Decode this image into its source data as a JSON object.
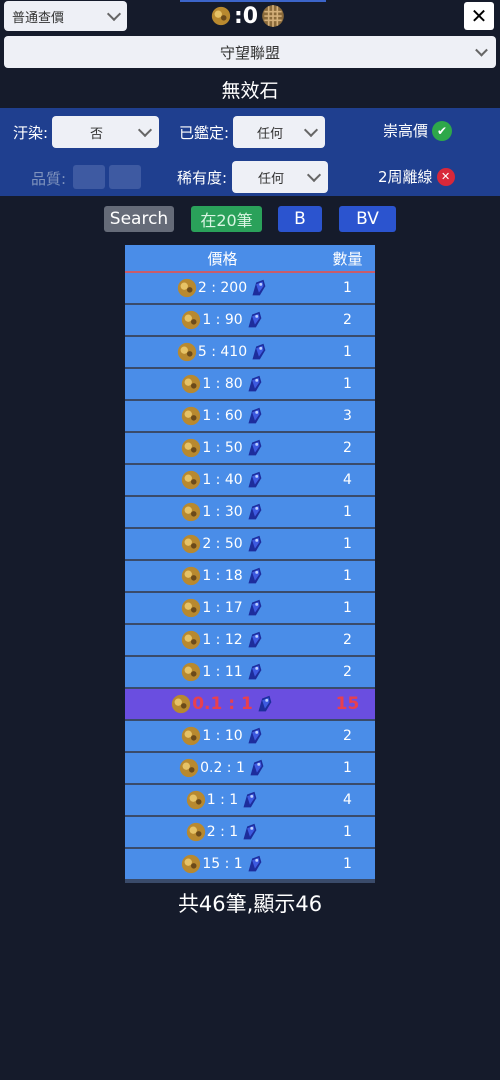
{
  "header": {
    "query_mode": "普通查價",
    "orb_count": ":0",
    "close_label": "✕",
    "league": "守望聯盟",
    "item_name": "無效石"
  },
  "filters": {
    "corrupted_label": "汙染:",
    "corrupted_value": "否",
    "identified_label": "已鑑定:",
    "identified_value": "任何",
    "exalted_label": "崇高價",
    "quality_label": "品質:",
    "rarity_label": "稀有度:",
    "rarity_value": "任何",
    "offline_label": "2周離線"
  },
  "actions": {
    "search": "Search",
    "count": "在20筆",
    "b": "B",
    "bv": "BV"
  },
  "table": {
    "headers": {
      "price": "價格",
      "qty": "數量"
    },
    "rows": [
      {
        "price": "2 : 200",
        "qty": "1"
      },
      {
        "price": "1 : 90",
        "qty": "2"
      },
      {
        "price": "5 : 410",
        "qty": "1"
      },
      {
        "price": "1 : 80",
        "qty": "1"
      },
      {
        "price": "1 : 60",
        "qty": "3"
      },
      {
        "price": "1 : 50",
        "qty": "2"
      },
      {
        "price": "1 : 40",
        "qty": "4"
      },
      {
        "price": "1 : 30",
        "qty": "1"
      },
      {
        "price": "2 : 50",
        "qty": "1"
      },
      {
        "price": "1 : 18",
        "qty": "1"
      },
      {
        "price": "1 : 17",
        "qty": "1"
      },
      {
        "price": "1 : 12",
        "qty": "2"
      },
      {
        "price": "1 : 11",
        "qty": "2"
      },
      {
        "price": "0.1 : 1",
        "qty": "15",
        "highlight": true
      },
      {
        "price": "1 : 10",
        "qty": "2"
      },
      {
        "price": "0.2 : 1",
        "qty": "1"
      },
      {
        "price": "1 : 1",
        "qty": "4"
      },
      {
        "price": "2 : 1",
        "qty": "1"
      },
      {
        "price": "15 : 1",
        "qty": "1"
      }
    ]
  },
  "summary": "共46筆,顯示46",
  "icons": {
    "left_currency": "exalted-orb-icon",
    "right_currency": "divine-orb-icon",
    "ok": "check-icon",
    "bad": "x-icon"
  },
  "colors": {
    "background": "#151b2b",
    "panel": "#1f3f8f",
    "table": "#4a8de8",
    "highlight_row": "#6a4ee0",
    "highlight_text": "#e8404e",
    "button_blue": "#2b54cf",
    "button_green": "#2aa15a"
  }
}
